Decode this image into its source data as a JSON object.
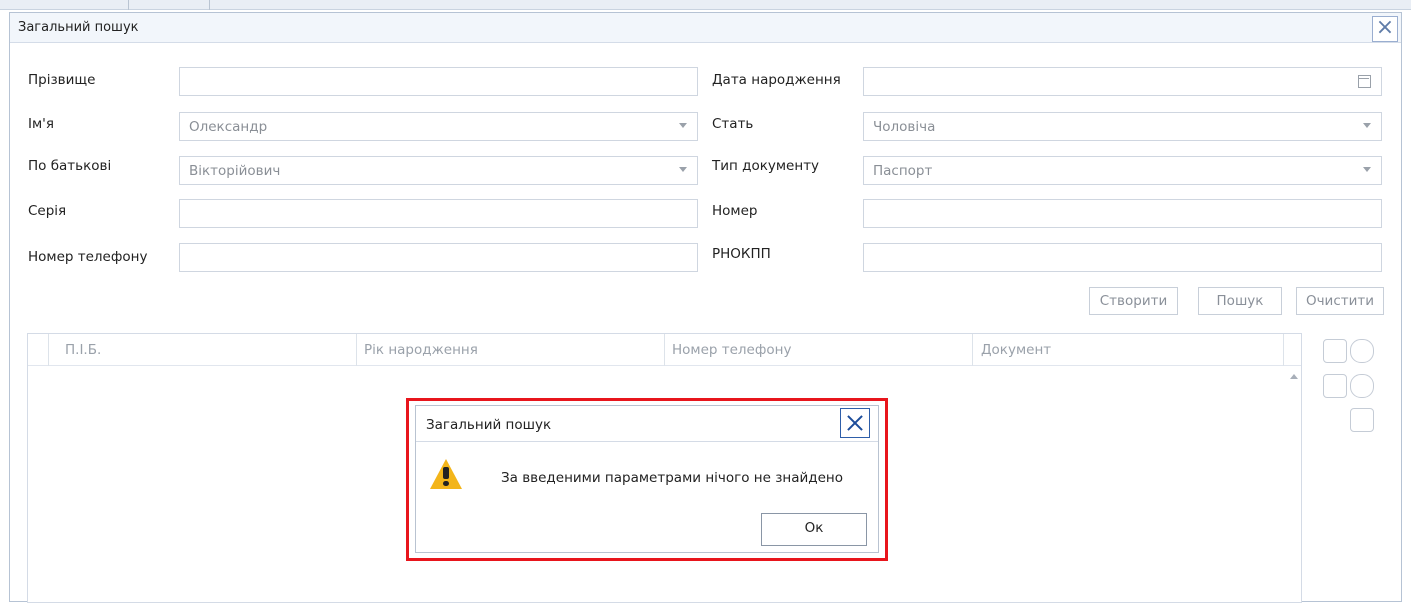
{
  "window": {
    "title": "Загальний пошук",
    "close_icon": "close-icon"
  },
  "form": {
    "left": [
      {
        "label": "Прізвище",
        "value": "",
        "type": "text"
      },
      {
        "label": "Ім'я",
        "value": "Олександр",
        "type": "select"
      },
      {
        "label": "По батькові",
        "value": "Вікторійович",
        "type": "select"
      },
      {
        "label": "Серія",
        "value": "",
        "type": "text"
      },
      {
        "label": "Номер телефону",
        "value": "",
        "type": "text"
      }
    ],
    "right": [
      {
        "label": "Дата народження",
        "value": "",
        "type": "date"
      },
      {
        "label": "Стать",
        "value": "Чоловіча",
        "type": "select"
      },
      {
        "label": "Тип документу",
        "value": "Паспорт",
        "type": "select"
      },
      {
        "label": "Номер",
        "value": "",
        "type": "text"
      },
      {
        "label": "РНОКПП",
        "value": "",
        "type": "text"
      }
    ]
  },
  "actions": {
    "create": "Створити",
    "search": "Пошук",
    "clear": "Очистити"
  },
  "grid": {
    "columns": [
      "П.І.Б.",
      "Рік народження",
      "Номер телефону",
      "Документ"
    ],
    "rows": []
  },
  "side_icons": [
    "export-doc-icon",
    "settings-icon",
    "edit-icon",
    "settings-icon",
    "excel-icon"
  ],
  "dialog": {
    "title": "Загальний пошук",
    "message": "За введеними параметрами нічого не знайдено",
    "ok_label": "Ок",
    "icon": "warning-icon"
  },
  "colors": {
    "highlight": "#e8151c",
    "warning": "#f3b51a",
    "dialog_close": "#1c4c9a"
  }
}
